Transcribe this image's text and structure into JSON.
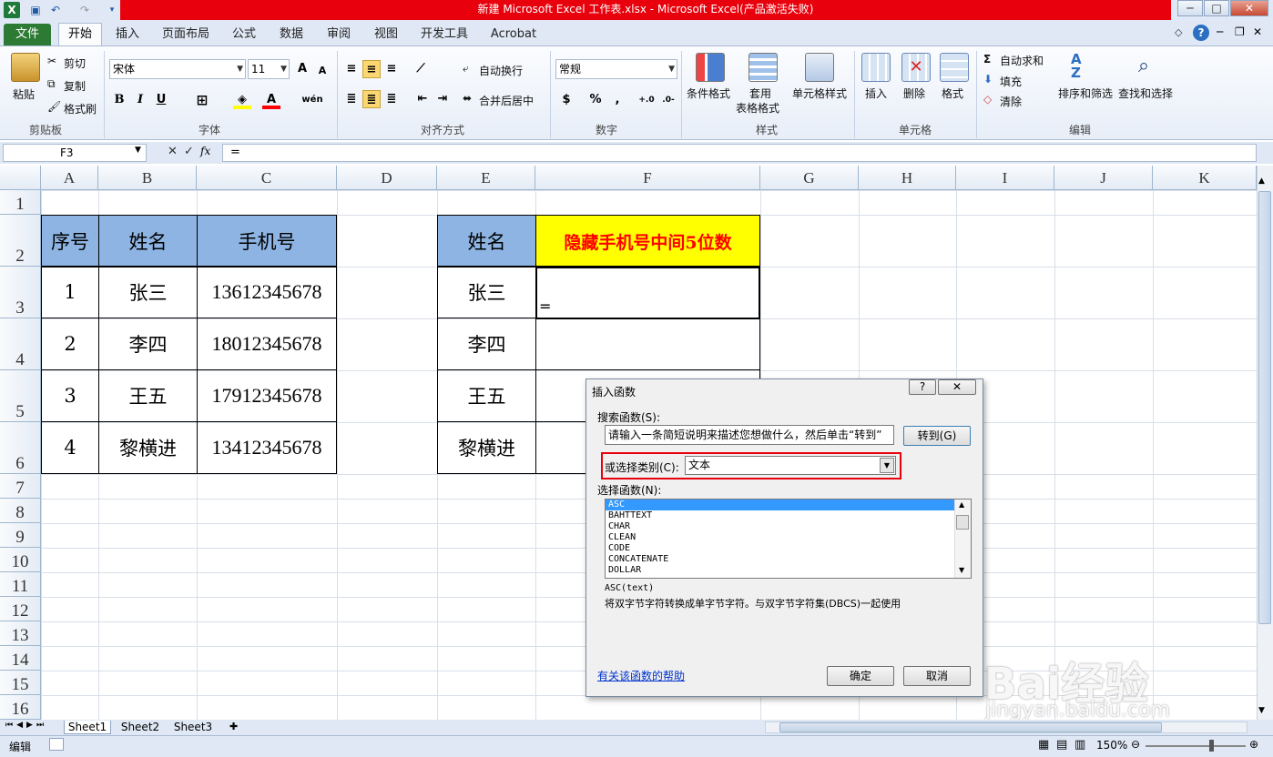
{
  "window": {
    "title": "新建 Microsoft Excel 工作表.xlsx - Microsoft Excel(产品激活失败)"
  },
  "ribbon": {
    "tabs": [
      "文件",
      "开始",
      "插入",
      "页面布局",
      "公式",
      "数据",
      "审阅",
      "视图",
      "开发工具",
      "Acrobat"
    ],
    "clipboard": {
      "paste": "粘贴",
      "cut": "剪切",
      "copy": "复制",
      "format_painter": "格式刷",
      "group": "剪贴板"
    },
    "font": {
      "name": "宋体",
      "size": "11",
      "group": "字体",
      "bold": "B",
      "italic": "I",
      "underline": "U",
      "grow": "A",
      "shrink": "A",
      "font_color": "A",
      "wen": "wén"
    },
    "align": {
      "wrap": "自动换行",
      "merge": "合并后居中",
      "group": "对齐方式"
    },
    "number": {
      "format": "常规",
      "group": "数字",
      "currency": "$",
      "percent": "%",
      "comma": ","
    },
    "styles": {
      "cond": "条件格式",
      "table1": "套用",
      "table2": "表格格式",
      "cell": "单元格样式",
      "group": "样式"
    },
    "cells": {
      "insert": "插入",
      "delete": "删除",
      "format": "格式",
      "group": "单元格"
    },
    "edit": {
      "autosum": "自动求和",
      "fill": "填充",
      "clear": "清除",
      "sort": "排序和筛选",
      "find": "查找和选择",
      "group": "编辑"
    }
  },
  "formula_bar": {
    "name_box": "F3",
    "fx": "fx",
    "content": "="
  },
  "sheet": {
    "columns": [
      "A",
      "B",
      "C",
      "D",
      "E",
      "F",
      "G",
      "H",
      "I",
      "J",
      "K"
    ],
    "rows": [
      "1",
      "2",
      "3",
      "4",
      "5",
      "6",
      "7",
      "8",
      "9",
      "10",
      "11",
      "12",
      "13",
      "14",
      "15",
      "16"
    ],
    "table1": {
      "headers": [
        "序号",
        "姓名",
        "手机号"
      ],
      "rows": [
        [
          "1",
          "张三",
          "13612345678"
        ],
        [
          "2",
          "李四",
          "18012345678"
        ],
        [
          "3",
          "王五",
          "17912345678"
        ],
        [
          "4",
          "黎横进",
          "13412345678"
        ]
      ]
    },
    "table2": {
      "headers": [
        "姓名",
        "隐藏手机号中间5位数"
      ],
      "names": [
        "张三",
        "李四",
        "王五",
        "黎横进"
      ],
      "f3": "="
    }
  },
  "sheet_tabs": [
    "Sheet1",
    "Sheet2",
    "Sheet3"
  ],
  "status": {
    "mode": "编辑",
    "zoom": "150%"
  },
  "dialog": {
    "title": "插入函数",
    "help_btn": "?",
    "search_label": "搜索函数(S):",
    "search_value": "请输入一条简短说明来描述您想做什么，然后单击“转到”",
    "goto": "转到(G)",
    "category_label": "或选择类别(C):",
    "category_value": "文本",
    "select_label": "选择函数(N):",
    "functions": [
      "ASC",
      "BAHTTEXT",
      "CHAR",
      "CLEAN",
      "CODE",
      "CONCATENATE",
      "DOLLAR"
    ],
    "signature": "ASC(text)",
    "description": "将双字节字符转换成单字节字符。与双字节字符集(DBCS)一起使用",
    "help_link": "有关该函数的帮助",
    "ok": "确定",
    "cancel": "取消"
  },
  "watermark": {
    "text": "Bai经验",
    "url": "jingyan.baidu.com"
  },
  "colors": {
    "header_blue": "#8db4e2",
    "header_yellow": "#ffff00",
    "red_text": "#ff0000",
    "title_red": "#e8000c",
    "highlight": "#e8000c"
  }
}
